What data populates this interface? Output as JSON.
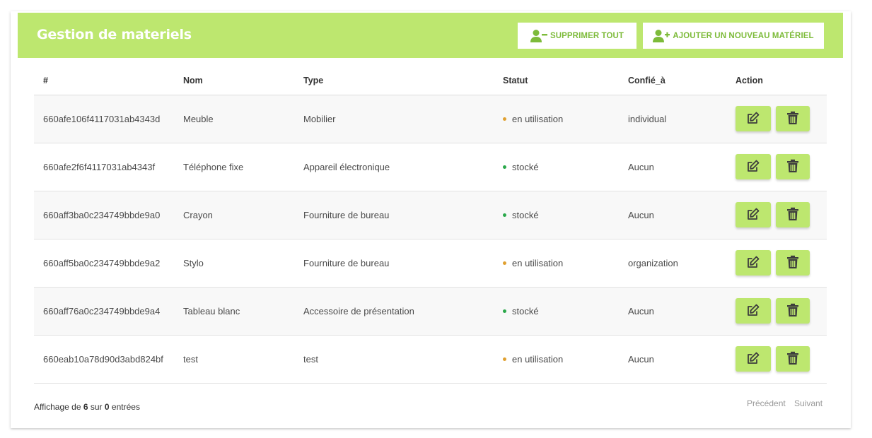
{
  "header": {
    "title": "Gestion de materiels",
    "delete_all_label": "SUPPRIMER TOUT",
    "add_label": "AJOUTER UN NOUVEAU MATÉRIEL"
  },
  "table": {
    "columns": [
      "#",
      "Nom",
      "Type",
      "Statut",
      "Confié_à",
      "Action"
    ],
    "rows": [
      {
        "id": "660afe106f4117031ab4343d",
        "nom": "Meuble",
        "type": "Mobilier",
        "statut": "en utilisation",
        "confie": "individual"
      },
      {
        "id": "660afe2f6f4117031ab4343f",
        "nom": "Téléphone fixe",
        "type": "Appareil électronique",
        "statut": "stocké",
        "confie": "Aucun"
      },
      {
        "id": "660aff3ba0c234749bbde9a0",
        "nom": "Crayon",
        "type": "Fourniture de bureau",
        "statut": "stocké",
        "confie": "Aucun"
      },
      {
        "id": "660aff5ba0c234749bbde9a2",
        "nom": "Stylo",
        "type": "Fourniture de bureau",
        "statut": "en utilisation",
        "confie": "organization"
      },
      {
        "id": "660aff76a0c234749bbde9a4",
        "nom": "Tableau blanc",
        "type": "Accessoire de présentation",
        "statut": "stocké",
        "confie": "Aucun"
      },
      {
        "id": "660eab10a78d90d3abd824bf",
        "nom": "test",
        "type": "test",
        "statut": "en utilisation",
        "confie": "Aucun"
      }
    ]
  },
  "footer": {
    "prefix": "Affichage de",
    "shown": "6",
    "middle": "sur",
    "total": "0",
    "suffix": "entrées",
    "prev_label": "Précédent",
    "next_label": "Suivant"
  },
  "colors": {
    "accent": "#bde76f",
    "accent_text": "#7dbb3a",
    "status_in_use": "#e0a030",
    "status_stored": "#2aa84a",
    "icon_dark": "#3d3d3d"
  },
  "icons": {
    "delete_all": "user-minus-icon",
    "add": "user-plus-icon",
    "edit": "edit-icon",
    "delete": "trash-icon"
  }
}
